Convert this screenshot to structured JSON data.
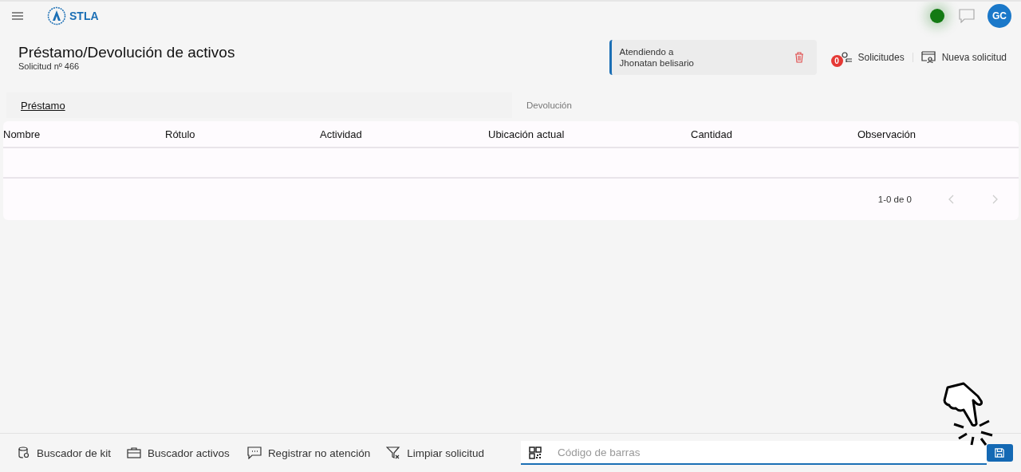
{
  "header": {
    "logo_text": "STLA",
    "online": true,
    "avatar": "GC"
  },
  "page": {
    "title": "Préstamo/Devolución de activos",
    "subtitle": "Solicitud nº 466"
  },
  "attending": {
    "label": "Atendiendo a",
    "name": "Jhonatan belisario"
  },
  "actions": [
    {
      "kind": "requests",
      "label": "Solicitudes",
      "badge": "0"
    },
    {
      "kind": "new",
      "label": "Nueva solicitud"
    }
  ],
  "tabs": [
    {
      "label": "Préstamo",
      "selected": true
    },
    {
      "label": "Devolución",
      "selected": false
    }
  ],
  "table": {
    "columns": [
      "Nombre",
      "Rótulo",
      "Actividad",
      "Ubicación actual",
      "Cantidad",
      "Observación"
    ],
    "pagination": "1-0 de 0"
  },
  "bottom_bar": {
    "tools": [
      {
        "kind": "kit",
        "label": "Buscador de kit"
      },
      {
        "kind": "briefcase",
        "label": "Buscador activos"
      },
      {
        "kind": "comment",
        "label": "Registrar no atención"
      },
      {
        "kind": "filter",
        "label": "Limpiar solicitud"
      }
    ],
    "barcode": {
      "placeholder": "Código de barras"
    }
  }
}
